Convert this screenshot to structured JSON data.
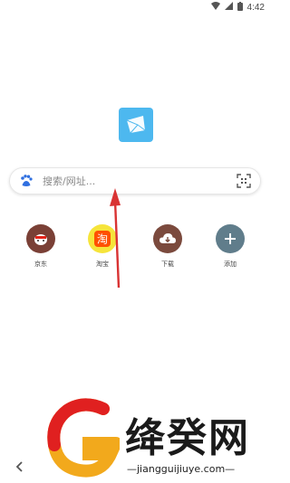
{
  "status_bar": {
    "time": "4:42"
  },
  "search": {
    "placeholder": "搜索/网址..."
  },
  "quick_links": [
    {
      "label": "京东",
      "color": "#7a4036"
    },
    {
      "label": "淘宝",
      "color": "#f6e43b"
    },
    {
      "label": "下载",
      "color": "#7b4a3d"
    },
    {
      "label": "添加",
      "color": "#607d8b"
    }
  ],
  "watermark": {
    "title": "绛癸网",
    "url": "jiangguijiuye.com"
  },
  "colors": {
    "logo_bg": "#4db8ef",
    "arrow": "#d93333"
  }
}
